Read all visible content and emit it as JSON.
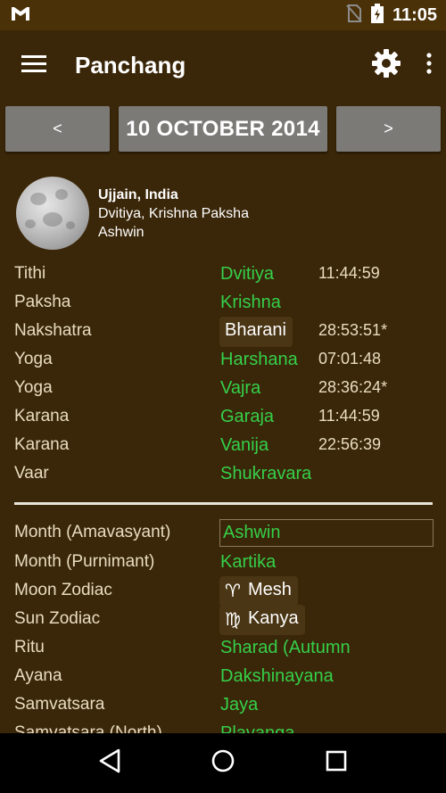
{
  "status": {
    "time": "11:05"
  },
  "appbar": {
    "title": "Panchang"
  },
  "datenav": {
    "prev": "<",
    "date": "10 OCTOBER 2014",
    "next": ">"
  },
  "location": {
    "city": "Ujjain, India",
    "detail": "Dvitiya, Krishna Paksha",
    "month": "Ashwin"
  },
  "section1": [
    {
      "label": "Tithi",
      "value": "Dvitiya",
      "time": "11:44:59"
    },
    {
      "label": "Paksha",
      "value": "Krishna",
      "time": ""
    },
    {
      "label": "Nakshatra",
      "value": "Bharani",
      "time": "28:53:51*"
    },
    {
      "label": "Yoga",
      "value": "Harshana",
      "time": "07:01:48"
    },
    {
      "label": "Yoga",
      "value": "Vajra",
      "time": "28:36:24*"
    },
    {
      "label": "Karana",
      "value": "Garaja",
      "time": "11:44:59"
    },
    {
      "label": "Karana",
      "value": "Vanija",
      "time": "22:56:39"
    },
    {
      "label": "Vaar",
      "value": "Shukravara",
      "time": ""
    }
  ],
  "section2": [
    {
      "label": "Month (Amavasyant)",
      "value": "Ashwin"
    },
    {
      "label": "Month (Purnimant)",
      "value": "Kartika"
    },
    {
      "label": "Moon Zodiac",
      "value": "Mesh",
      "symbol": "♈"
    },
    {
      "label": "Sun Zodiac",
      "value": "Kanya",
      "symbol": "♍"
    },
    {
      "label": "Ritu",
      "value": "Sharad (Autumn"
    },
    {
      "label": "Ayana",
      "value": "Dakshinayana"
    },
    {
      "label": "Samvatsara",
      "value": "Jaya"
    },
    {
      "label": "Samvatsara (North)",
      "value": "Plavanga"
    }
  ],
  "colors": {
    "background": "#3a2608",
    "value_green": "#35d04a",
    "button_grey": "#7c7a77"
  }
}
